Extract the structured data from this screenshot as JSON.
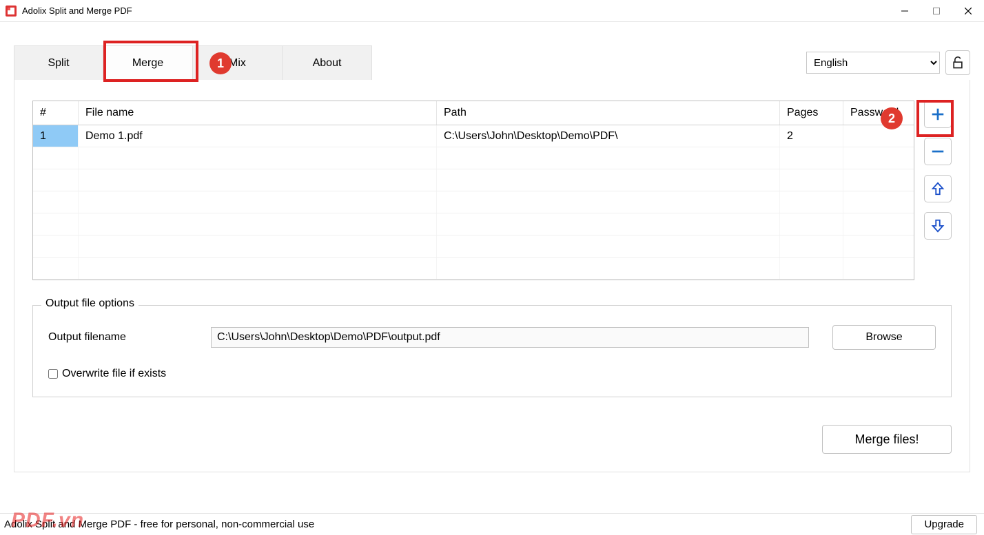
{
  "window": {
    "title": "Adolix Split and Merge PDF"
  },
  "tabs": {
    "items": [
      "Split",
      "Merge",
      "Mix",
      "About"
    ],
    "active_index": 1
  },
  "language": {
    "selected": "English"
  },
  "table": {
    "headers": {
      "num": "#",
      "file": "File name",
      "path": "Path",
      "pages": "Pages",
      "password": "Password"
    },
    "rows": [
      {
        "num": "1",
        "file": "Demo 1.pdf",
        "path": "C:\\Users\\John\\Desktop\\Demo\\PDF\\",
        "pages": "2",
        "password": ""
      }
    ]
  },
  "output": {
    "legend": "Output file options",
    "filename_label": "Output filename",
    "filename_value": "C:\\Users\\John\\Desktop\\Demo\\PDF\\output.pdf",
    "browse": "Browse",
    "overwrite_label": "Overwrite file if exists"
  },
  "actions": {
    "merge": "Merge files!",
    "upgrade": "Upgrade"
  },
  "status": {
    "text": "Adolix Split and Merge PDF - free for personal, non-commercial use"
  },
  "watermark": "PDF.vn",
  "annotations": {
    "one": "1",
    "two": "2"
  }
}
